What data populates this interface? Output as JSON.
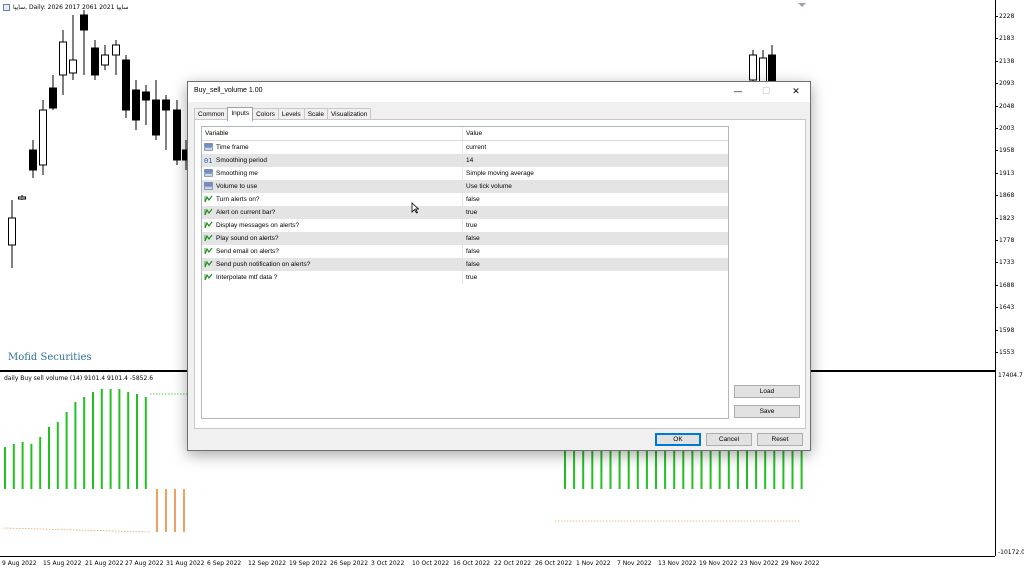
{
  "chart": {
    "header_text": "سایپا, Daily:  2026 2017 2061 2021  سایپا",
    "watermark": "Mofid Securities",
    "indicator_header": "daily Buy sell volume (14) 9101.4 9101.4 -5852.6",
    "price_labels": [
      "2228",
      "2183",
      "2138",
      "2093",
      "2048",
      "2003",
      "1958",
      "1913",
      "1868",
      "1823",
      "1778",
      "1733",
      "1688",
      "1643",
      "1598",
      "1553"
    ],
    "sub_price_labels": [
      "17404.7",
      "-10172.0"
    ],
    "time_labels": [
      "9 Aug 2022",
      "15 Aug 2022",
      "21 Aug 2022",
      "27 Aug 2022",
      "31 Aug 2022",
      "6 Sep 2022",
      "12 Sep 2022",
      "19 Sep 2022",
      "26 Sep 2022",
      "3 Oct 2022",
      "10 Oct 2022",
      "16 Oct 2022",
      "22 Oct 2022",
      "26 Oct 2022",
      "1 Nov 2022",
      "7 Nov 2022",
      "13 Nov 2022",
      "19 Nov 2022",
      "23 Nov 2022",
      "29 Nov 2022"
    ],
    "colors": {
      "bull_bar": "#22c022",
      "bear_bar": "#f0a060",
      "candle": "#000000"
    }
  },
  "dialog": {
    "title": "Buy_sell_volume 1.00",
    "window_buttons": {
      "minimize": "—",
      "maximize": "☐",
      "close": "✕"
    },
    "tabs": [
      "Common",
      "Inputs",
      "Colors",
      "Levels",
      "Scale",
      "Visualization"
    ],
    "active_tab": "Inputs",
    "columns": {
      "variable": "Variable",
      "value": "Value"
    },
    "rows": [
      {
        "variable": "Time frame",
        "value": "current",
        "icon": "enum-icon"
      },
      {
        "variable": "Smoothing period",
        "value": "14",
        "icon": "integer-icon"
      },
      {
        "variable": "Smoothing me",
        "value": "Simple moving average",
        "icon": "enum-icon"
      },
      {
        "variable": "Volume to use",
        "value": "Use tick volume",
        "icon": "enum-icon"
      },
      {
        "variable": "Turn alerts on?",
        "value": "false",
        "icon": "bool-icon"
      },
      {
        "variable": "Alert on current bar?",
        "value": "true",
        "icon": "bool-icon"
      },
      {
        "variable": "Display messages on alerts?",
        "value": "true",
        "icon": "bool-icon"
      },
      {
        "variable": "Play sound on alerts?",
        "value": "false",
        "icon": "bool-icon"
      },
      {
        "variable": "Send email on alerts?",
        "value": "false",
        "icon": "bool-icon"
      },
      {
        "variable": "Send push notification on alerts?",
        "value": "false",
        "icon": "bool-icon"
      },
      {
        "variable": "Interpolate mtf data ?",
        "value": "true",
        "icon": "bool-icon"
      }
    ],
    "buttons": {
      "load": "Load",
      "save": "Save",
      "ok": "OK",
      "cancel": "Cancel",
      "reset": "Reset"
    }
  }
}
